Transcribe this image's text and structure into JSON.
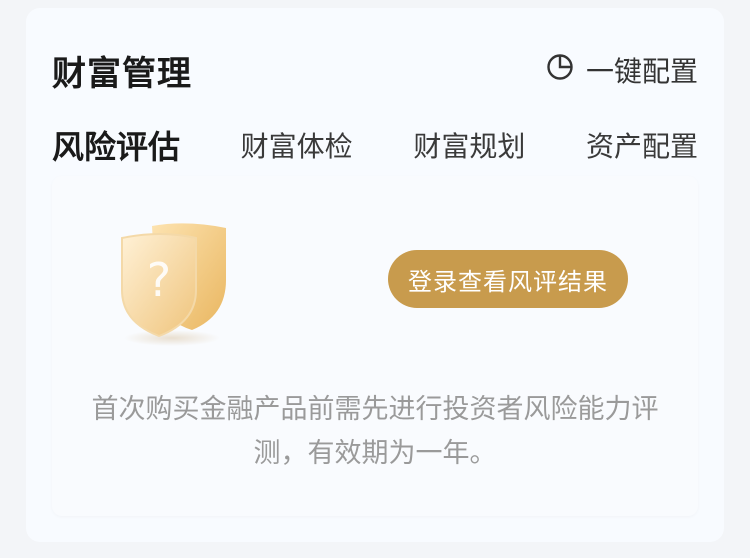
{
  "header": {
    "title": "财富管理",
    "quick_config_label": "一键配置",
    "quick_config_icon": "pie-chart-icon"
  },
  "tabs": [
    {
      "label": "风险评估",
      "active": true
    },
    {
      "label": "财富体检",
      "active": false
    },
    {
      "label": "财富规划",
      "active": false
    },
    {
      "label": "资产配置",
      "active": false
    }
  ],
  "panel": {
    "illustration_icon": "question-shield-icon",
    "cta_label": "登录查看风评结果",
    "description": "首次购买金融产品前需先进行投资者风险能力评测，有效期为一年。"
  },
  "colors": {
    "accent": "#c89b4d",
    "title_text": "#1a1a1a",
    "muted_text": "#9a9a9a",
    "card_bg": "#f8fbff"
  }
}
